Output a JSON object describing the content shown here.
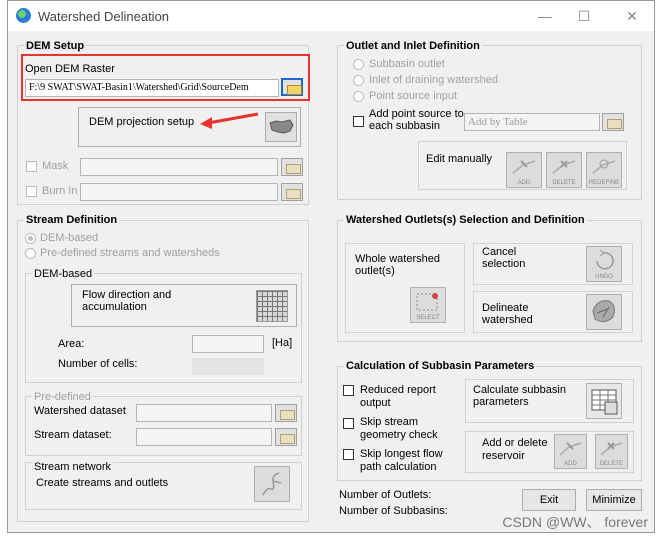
{
  "window": {
    "title": "Watershed Delineation",
    "minimize": "—",
    "maximize": "☐",
    "close": "✕"
  },
  "dem_setup": {
    "title": "DEM Setup",
    "open_dem_label": "Open DEM Raster",
    "dem_path": "F:\\9 SWAT\\SWAT-Basin1\\Watershed\\Grid\\SourceDem",
    "projection_label": "DEM projection setup",
    "mask_label": "Mask",
    "burn_in_label": "Burn In"
  },
  "stream_definition": {
    "title": "Stream Definition",
    "option_dem_based": "DEM-based",
    "option_predefined": "Pre-defined streams and watersheds",
    "dem_based_title": "DEM-based",
    "flow_direction_label": "Flow direction and accumulation",
    "area_label": "Area:",
    "area_unit": "[Ha]",
    "cells_label": "Number of cells:",
    "predefined_title": "Pre-defined",
    "watershed_dataset_label": "Watershed dataset",
    "stream_dataset_label": "Stream dataset:",
    "stream_network_title": "Stream network",
    "create_streams_label": "Create streams and outlets"
  },
  "outlet_inlet": {
    "title": "Outlet and Inlet Definition",
    "subbasin_outlet": "Subbasin outlet",
    "inlet_draining": "Inlet of draining watershed",
    "point_source": "Point source input",
    "add_point_source": "Add point source to each subbasin",
    "add_by_table": "Add by Table",
    "edit_manually": "Edit manually",
    "icon_add": "ADD",
    "icon_delete": "DELETE",
    "icon_redefine": "REDEFINE"
  },
  "watershed_outlets": {
    "title": "Watershed Outlets(s) Selection and Definition",
    "whole_outlet": "Whole watershed outlet(s)",
    "cancel_selection": "Cancel selection",
    "delineate": "Delineate watershed",
    "icon_select": "SELECT",
    "icon_undo": "UNDO"
  },
  "subbasin_params": {
    "title": "Calculation of Subbasin Parameters",
    "reduced_report": "Reduced  report output",
    "skip_stream": "Skip stream geometry check",
    "skip_longest": "Skip longest flow path calculation",
    "calculate": "Calculate subbasin parameters",
    "add_delete_reservoir": "Add or delete reservoir",
    "icon_add": "ADD",
    "icon_delete": "DELETE"
  },
  "footer": {
    "outlets_label": "Number of Outlets:",
    "subbasins_label": "Number of Subbasins:",
    "exit": "Exit",
    "minimize": "Minimize"
  },
  "watermark": "CSDN @WW、 forever",
  "colors": {
    "highlight": "#e8342f",
    "folder_active_border": "#1a66d0"
  }
}
